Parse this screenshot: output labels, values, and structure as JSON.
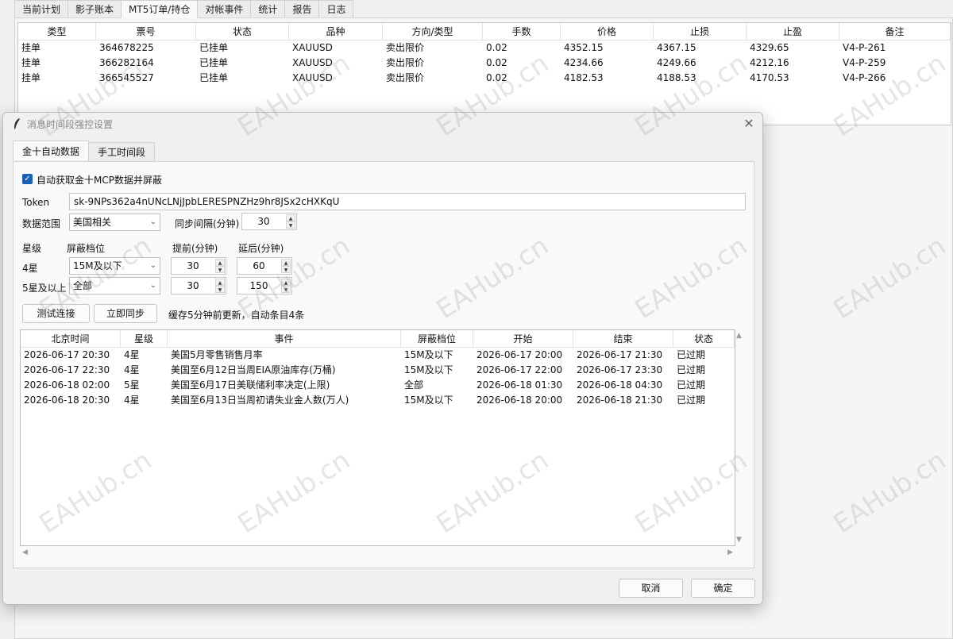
{
  "main_tabs": [
    "当前计划",
    "影子账本",
    "MT5订单/持仓",
    "对帐事件",
    "统计",
    "报告",
    "日志"
  ],
  "orders": {
    "headers": [
      "类型",
      "票号",
      "状态",
      "品种",
      "方向/类型",
      "手数",
      "价格",
      "止损",
      "止盈",
      "备注"
    ],
    "rows": [
      [
        "挂单",
        "364678225",
        "已挂单",
        "XAUUSD",
        "卖出限价",
        "0.02",
        "4352.15",
        "4367.15",
        "4329.65",
        "V4-P-261"
      ],
      [
        "挂单",
        "366282164",
        "已挂单",
        "XAUUSD",
        "卖出限价",
        "0.02",
        "4234.66",
        "4249.66",
        "4212.16",
        "V4-P-259"
      ],
      [
        "挂单",
        "366545527",
        "已挂单",
        "XAUUSD",
        "卖出限价",
        "0.02",
        "4182.53",
        "4188.53",
        "4170.53",
        "V4-P-266"
      ]
    ]
  },
  "dialog": {
    "title": "消息时间段强控设置",
    "tabs": [
      "金十自动数据",
      "手工时间段"
    ],
    "auto_fetch_label": "自动获取金十MCP数据并屏蔽",
    "token_label": "Token",
    "token_value": "sk-9NPs362a4nUNcLNjJpbLERESPNZHz9hr8JSx2cHXKqU",
    "scope_label": "数据范围",
    "scope_value": "美国相关",
    "sync_interval_label": "同步间隔(分钟)",
    "sync_interval_value": "30",
    "col_star": "星级",
    "col_block_level": "屏蔽档位",
    "col_before": "提前(分钟)",
    "col_after": "延后(分钟)",
    "star4_label": "4星",
    "star4_level": "15M及以下",
    "star4_before": "30",
    "star4_after": "60",
    "star5_label": "5星及以上",
    "star5_level": "全部",
    "star5_before": "30",
    "star5_after": "150",
    "test_button": "测试连接",
    "sync_button": "立即同步",
    "cache_status": "缓存5分钟前更新，自动条目4条",
    "cancel_button": "取消",
    "ok_button": "确定"
  },
  "events": {
    "headers": [
      "北京时间",
      "星级",
      "事件",
      "屏蔽档位",
      "开始",
      "结束",
      "状态"
    ],
    "rows": [
      [
        "2026-06-17 20:30",
        "4星",
        "美国5月零售销售月率",
        "15M及以下",
        "2026-06-17 20:00",
        "2026-06-17 21:30",
        "已过期"
      ],
      [
        "2026-06-17 22:30",
        "4星",
        "美国至6月12日当周EIA原油库存(万桶)",
        "15M及以下",
        "2026-06-17 22:00",
        "2026-06-17 23:30",
        "已过期"
      ],
      [
        "2026-06-18 02:00",
        "5星",
        "美国至6月17日美联储利率决定(上限)",
        "全部",
        "2026-06-18 01:30",
        "2026-06-18 04:30",
        "已过期"
      ],
      [
        "2026-06-18 20:30",
        "4星",
        "美国至6月13日当周初请失业金人数(万人)",
        "15M及以下",
        "2026-06-18 20:00",
        "2026-06-18 21:30",
        "已过期"
      ]
    ]
  },
  "watermark": "EAHub.cn",
  "colors": {
    "accent": "#1a5fb4",
    "dialog_bg": "#f0f0f0"
  }
}
